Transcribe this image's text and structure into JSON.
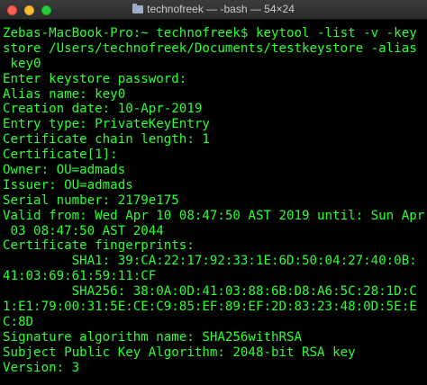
{
  "window": {
    "title": "technofreek — -bash — 54×24"
  },
  "terminal": {
    "lines": [
      "Zebas-MacBook-Pro:~ technofreek$ keytool -list -v -key",
      "store /Users/technofreek/Documents/testkeystore -alias",
      " key0",
      "Enter keystore password:",
      "Alias name: key0",
      "Creation date: 10-Apr-2019",
      "Entry type: PrivateKeyEntry",
      "Certificate chain length: 1",
      "Certificate[1]:",
      "Owner: OU=admads",
      "Issuer: OU=admads",
      "Serial number: 2179e175",
      "Valid from: Wed Apr 10 08:47:50 AST 2019 until: Sun Apr",
      " 03 08:47:50 AST 2044",
      "Certificate fingerprints:",
      "         SHA1: 39:CA:22:17:92:33:1E:6D:50:04:27:40:0B:",
      "41:03:69:61:59:11:CF",
      "         SHA256: 38:0A:0D:41:03:88:6B:D8:A6:5C:28:1D:C",
      "1:E1:79:00:31:5E:CE:C9:85:EF:89:EF:2D:83:23:48:0D:5E:E",
      "C:8D",
      "Signature algorithm name: SHA256withRSA",
      "Subject Public Key Algorithm: 2048-bit RSA key",
      "Version: 3"
    ]
  },
  "colors": {
    "terminal_background": "#000000",
    "terminal_text": "#2bff33",
    "titlebar_text": "#c9c9c9"
  }
}
